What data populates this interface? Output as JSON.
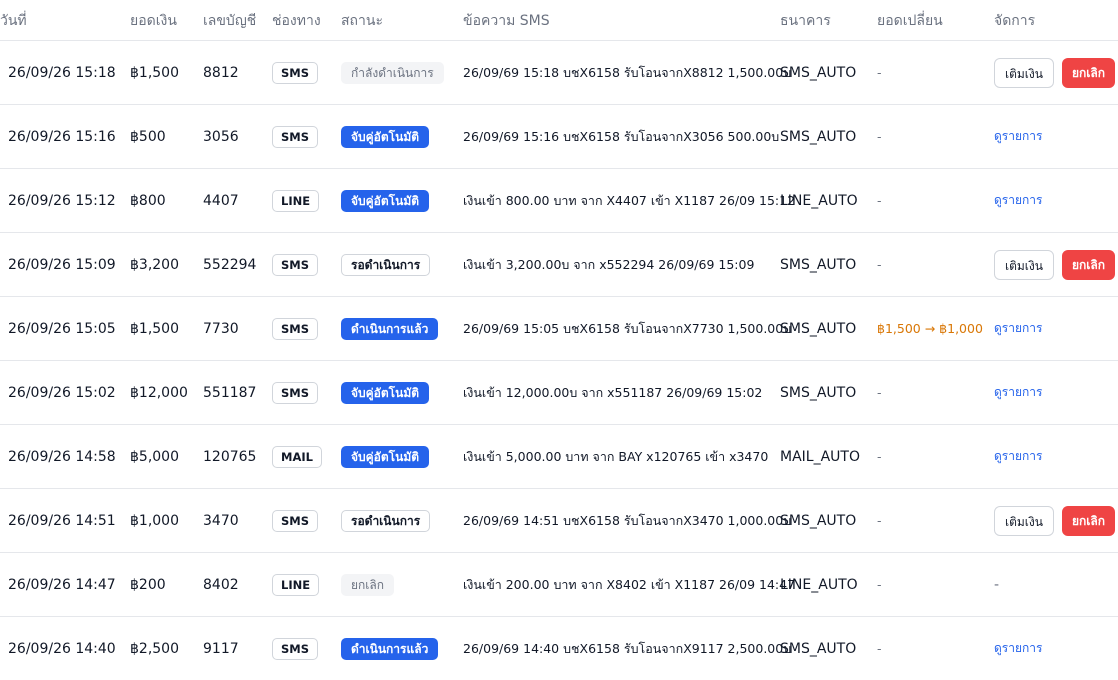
{
  "header": {
    "date": "วันที่",
    "amount": "ยอดเงิน",
    "account": "เลขบัญชี",
    "channel": "ช่องทาง",
    "status": "สถานะ",
    "sms": "ข้อความ SMS",
    "bank": "ธนาคาร",
    "change": "ยอดเปลี่ยน",
    "action": "จัดการ"
  },
  "labels": {
    "topup": "เติมเงิน",
    "cancel": "ยกเลิก",
    "view": "ดูรายการ",
    "dash": "-"
  },
  "rows": [
    {
      "date": "26/09/26 15:18",
      "amount": "฿1,500",
      "account": "8812",
      "channel": "SMS",
      "status": "กำลังดำเนินการ",
      "status_kind": "processing",
      "sms": "26/09/69 15:18 บชX6158 รับโอนจากX8812 1,500.00บ",
      "bank": "SMS_AUTO",
      "change": "-",
      "action": "buttons"
    },
    {
      "date": "26/09/26 15:16",
      "amount": "฿500",
      "account": "3056",
      "channel": "SMS",
      "status": "จับคู่อัตโนมัติ",
      "status_kind": "auto",
      "sms": "26/09/69 15:16 บชX6158 รับโอนจากX3056 500.00บ",
      "bank": "SMS_AUTO",
      "change": "-",
      "action": "view"
    },
    {
      "date": "26/09/26 15:12",
      "amount": "฿800",
      "account": "4407",
      "channel": "LINE",
      "status": "จับคู่อัตโนมัติ",
      "status_kind": "auto",
      "sms": "เงินเข้า 800.00 บาท จาก X4407 เข้า X1187 26/09 15:12",
      "bank": "LINE_AUTO",
      "change": "-",
      "action": "view"
    },
    {
      "date": "26/09/26 15:09",
      "amount": "฿3,200",
      "account": "552294",
      "channel": "SMS",
      "status": "รอดำเนินการ",
      "status_kind": "waiting",
      "sms": "เงินเข้า 3,200.00บ จาก x552294 26/09/69 15:09",
      "bank": "SMS_AUTO",
      "change": "-",
      "action": "buttons"
    },
    {
      "date": "26/09/26 15:05",
      "amount": "฿1,500",
      "account": "7730",
      "channel": "SMS",
      "status": "ดำเนินการแล้ว",
      "status_kind": "done",
      "sms": "26/09/69 15:05 บชX6158 รับโอนจากX7730 1,500.00บ",
      "bank": "SMS_AUTO",
      "change": "฿1,500 → ฿1,000",
      "action": "view"
    },
    {
      "date": "26/09/26 15:02",
      "amount": "฿12,000",
      "account": "551187",
      "channel": "SMS",
      "status": "จับคู่อัตโนมัติ",
      "status_kind": "auto",
      "sms": "เงินเข้า 12,000.00บ จาก x551187 26/09/69 15:02",
      "bank": "SMS_AUTO",
      "change": "-",
      "action": "view"
    },
    {
      "date": "26/09/26 14:58",
      "amount": "฿5,000",
      "account": "120765",
      "channel": "MAIL",
      "status": "จับคู่อัตโนมัติ",
      "status_kind": "auto",
      "sms": "เงินเข้า 5,000.00 บาท จาก BAY x120765 เข้า x3470",
      "bank": "MAIL_AUTO",
      "change": "-",
      "action": "view"
    },
    {
      "date": "26/09/26 14:51",
      "amount": "฿1,000",
      "account": "3470",
      "channel": "SMS",
      "status": "รอดำเนินการ",
      "status_kind": "waiting",
      "sms": "26/09/69 14:51 บชX6158 รับโอนจากX3470 1,000.00บ",
      "bank": "SMS_AUTO",
      "change": "-",
      "action": "buttons"
    },
    {
      "date": "26/09/26 14:47",
      "amount": "฿200",
      "account": "8402",
      "channel": "LINE",
      "status": "ยกเลิก",
      "status_kind": "cancel",
      "sms": "เงินเข้า 200.00 บาท จาก X8402 เข้า X1187 26/09 14:47",
      "bank": "LINE_AUTO",
      "change": "-",
      "action": "dash"
    },
    {
      "date": "26/09/26 14:40",
      "amount": "฿2,500",
      "account": "9117",
      "channel": "SMS",
      "status": "ดำเนินการแล้ว",
      "status_kind": "done",
      "sms": "26/09/69 14:40 บชX6158 รับโอนจากX9117 2,500.00บ",
      "bank": "SMS_AUTO",
      "change": "-",
      "action": "view"
    }
  ]
}
